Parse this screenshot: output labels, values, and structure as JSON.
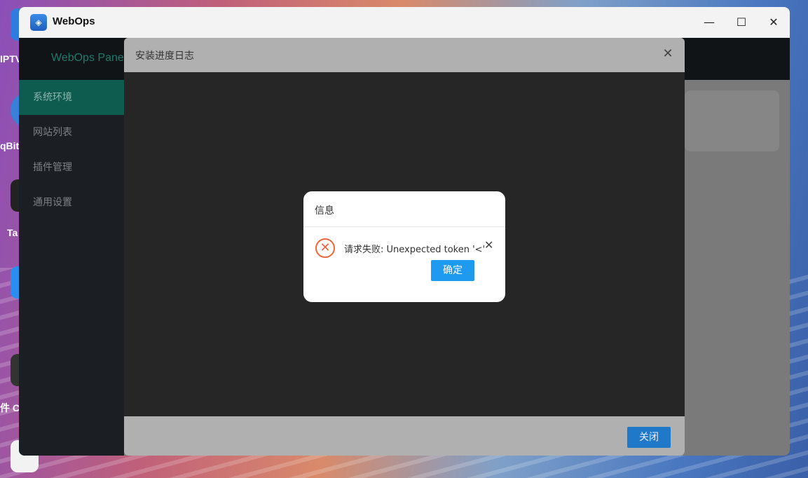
{
  "desktop": {
    "labels": [
      "IPTV",
      "qBit",
      "Ta",
      "件 C"
    ]
  },
  "window": {
    "app_title": "WebOps",
    "minimize_glyph": "—",
    "maximize_glyph": "☐",
    "close_glyph": "✕"
  },
  "header": {
    "brand": "WebOps Pane"
  },
  "sidebar": {
    "items": [
      {
        "label": "系统环境",
        "active": true
      },
      {
        "label": "网站列表"
      },
      {
        "label": "插件管理"
      },
      {
        "label": "通用设置"
      }
    ]
  },
  "log_dialog": {
    "title": "安装进度日志",
    "close_glyph": "✕",
    "close_button": "关闭"
  },
  "message_box": {
    "title": "信息",
    "icon": "error-circle-icon",
    "text": "请求失败: Unexpected token '<', \"",
    "close_glyph": "✕",
    "ok_button": "确定"
  },
  "colors": {
    "sidebar_active": "#0e5c50",
    "primary_button": "#1e9bf0",
    "error": "#f0643c"
  }
}
